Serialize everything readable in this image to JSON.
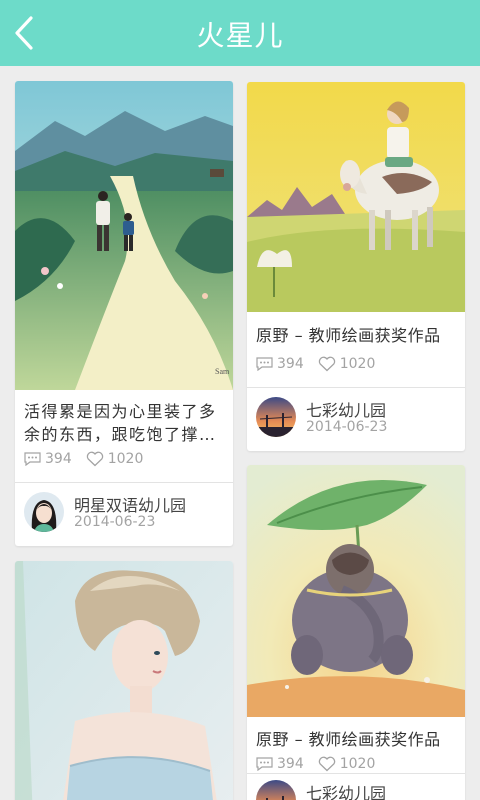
{
  "header": {
    "title": "火星儿",
    "back_icon": "chevron-left-icon",
    "bg_color": "#6ddbc9"
  },
  "feed": {
    "left": [
      {
        "caption": "活得累是因为心里装了多余的东西，跟吃饱了撑的是一样的。",
        "image_signature": "Sam",
        "comments": "394",
        "likes": "1020",
        "author": "明星双语幼儿园",
        "date": "2014-06-23"
      },
      {
        "caption": "",
        "comments": "",
        "likes": "",
        "author": "",
        "date": ""
      }
    ],
    "right": [
      {
        "caption": "原野 – 教师绘画获奖作品",
        "comments": "394",
        "likes": "1020",
        "author": "七彩幼儿园",
        "date": "2014-06-23"
      },
      {
        "caption": "原野 – 教师绘画获奖作品",
        "comments": "394",
        "likes": "1020",
        "author": "七彩幼儿园",
        "date": ""
      }
    ]
  },
  "icons": {
    "comment": "comment-icon",
    "like": "heart-icon"
  },
  "colors": {
    "stat_text": "#a3a3a3",
    "caption_text": "#333333",
    "background": "#ededed"
  }
}
